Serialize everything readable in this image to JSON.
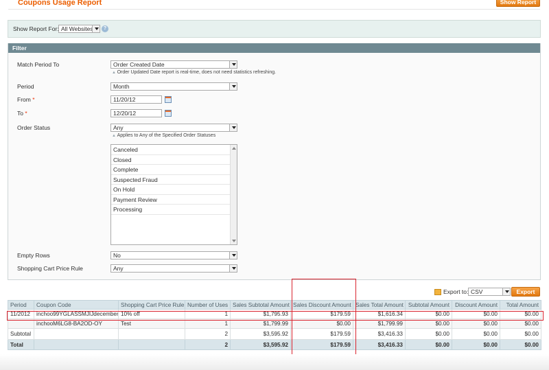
{
  "header": {
    "title": "Coupons Usage Report",
    "show_report_label": "Show Report"
  },
  "switcher": {
    "label": "Show Report For:",
    "value": "All Websites"
  },
  "filter": {
    "title": "Filter",
    "match_period": {
      "label": "Match Period To",
      "value": "Order Created Date",
      "note": "Order Updated Date report is real-time, does not need statistics refreshing."
    },
    "period": {
      "label": "Period",
      "value": "Month"
    },
    "from": {
      "label": "From",
      "required": "*",
      "value": "11/20/12"
    },
    "to": {
      "label": "To",
      "required": "*",
      "value": "12/20/12"
    },
    "order_status": {
      "label": "Order Status",
      "value": "Any",
      "note": "Applies to Any of the Specified Order Statuses",
      "options": [
        "Canceled",
        "Closed",
        "Complete",
        "Suspected Fraud",
        "On Hold",
        "Payment Review",
        "Processing"
      ]
    },
    "empty_rows": {
      "label": "Empty Rows",
      "value": "No"
    },
    "cart_rule": {
      "label": "Shopping Cart Price Rule",
      "value": "Any"
    }
  },
  "export": {
    "label": "Export to:",
    "format": "CSV",
    "button": "Export"
  },
  "grid": {
    "headers": [
      "Period",
      "Coupon Code",
      "Shopping Cart Price Rule",
      "Number of Uses",
      "Sales Subtotal Amount",
      "Sales Discount Amount",
      "Sales Total Amount",
      "Subtotal Amount",
      "Discount Amount",
      "Total Amount"
    ],
    "rows": [
      [
        "11/2012",
        "inchoo99YGLASSMJIJdecember",
        "10% off",
        "1",
        "$1,795.93",
        "$179.59",
        "$1,616.34",
        "$0.00",
        "$0.00",
        "$0.00"
      ],
      [
        "",
        "inchooM6LG8-BA2OD-OY",
        "Test",
        "1",
        "$1,799.99",
        "$0.00",
        "$1,799.99",
        "$0.00",
        "$0.00",
        "$0.00"
      ]
    ],
    "subtotal": [
      "Subtotal",
      "",
      "",
      "2",
      "$3,595.92",
      "$179.59",
      "$3,416.33",
      "$0.00",
      "$0.00",
      "$0.00"
    ],
    "total": [
      "Total",
      "",
      "",
      "2",
      "$3,595.92",
      "$179.59",
      "$3,416.33",
      "$0.00",
      "$0.00",
      "$0.00"
    ]
  },
  "colors": {
    "accent": "#eb5e00",
    "highlight": "#d9232e",
    "fieldset_head": "#6f8992",
    "grid_header": "#d9e5ea"
  }
}
